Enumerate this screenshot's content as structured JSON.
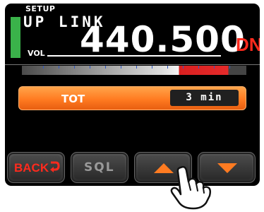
{
  "screen": {
    "mode": "SETUP",
    "band": "UP LINK",
    "frequency": "440.500",
    "vol_label": "VOL",
    "shift": "DN"
  },
  "setting": {
    "label": "TOT",
    "value": "3 min"
  },
  "buttons": {
    "back": "BACK",
    "sql": "SQL",
    "up_icon": "triangle-up-icon",
    "down_icon": "triangle-down-icon"
  },
  "colors": {
    "accent_orange": "#ff7b21",
    "alert_red": "#ff2a1d",
    "status_green": "#3ab24a",
    "screen_bg": "#000000"
  }
}
